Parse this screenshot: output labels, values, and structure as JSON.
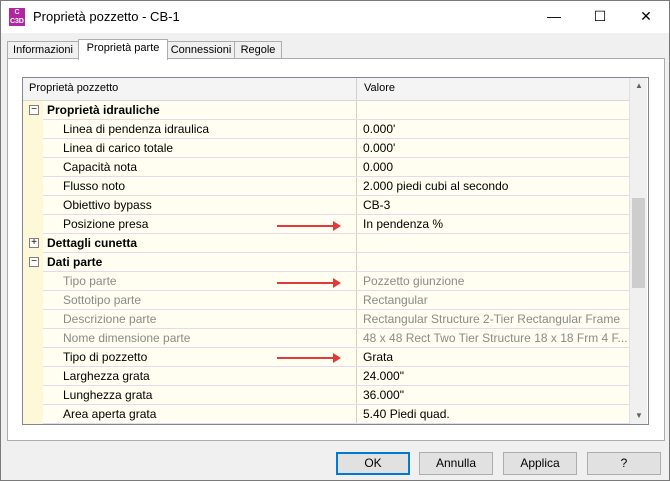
{
  "window": {
    "title": "Proprietà pozzetto - CB-1",
    "app_icon_text": "C\nC3D"
  },
  "window_controls": {
    "minimize": "—",
    "maximize": "☐",
    "close": "✕"
  },
  "tabs": [
    "Informazioni",
    "Proprietà parte",
    "Connessioni",
    "Regole"
  ],
  "active_tab": 1,
  "grid": {
    "col_name": "Proprietà pozzetto",
    "col_value": "Valore",
    "rows": [
      {
        "type": "category",
        "label": "Proprietà idrauliche",
        "expander": "−"
      },
      {
        "type": "prop",
        "label": "Linea di pendenza idraulica",
        "value": "0.000'"
      },
      {
        "type": "prop",
        "label": "Linea di carico totale",
        "value": "0.000'"
      },
      {
        "type": "prop",
        "label": "Capacità nota",
        "value": "0.000"
      },
      {
        "type": "prop",
        "label": "Flusso noto",
        "value": "2.000 piedi cubi al secondo"
      },
      {
        "type": "prop",
        "label": "Obiettivo bypass",
        "value": "CB-3"
      },
      {
        "type": "prop",
        "label": "Posizione presa",
        "value": "In pendenza %"
      },
      {
        "type": "category",
        "label": "Dettagli cunetta",
        "expander": "+"
      },
      {
        "type": "category",
        "label": "Dati parte",
        "expander": "−"
      },
      {
        "type": "disabled",
        "label": "Tipo parte",
        "value": "Pozzetto giunzione"
      },
      {
        "type": "disabled",
        "label": "Sottotipo parte",
        "value": "Rectangular"
      },
      {
        "type": "disabled",
        "label": "Descrizione parte",
        "value": "Rectangular Structure 2-Tier Rectangular Frame"
      },
      {
        "type": "disabled",
        "label": "Nome dimensione parte",
        "value": "48 x 48 Rect Two Tier Structure 18 x 18 Frm 4 F..."
      },
      {
        "type": "prop",
        "label": "Tipo di pozzetto",
        "value": "Grata"
      },
      {
        "type": "prop",
        "label": "Larghezza grata",
        "value": "24.000\""
      },
      {
        "type": "prop",
        "label": "Lunghezza grata",
        "value": "36.000\""
      },
      {
        "type": "prop",
        "label": "Area aperta grata",
        "value": "5.40 Piedi quad."
      }
    ]
  },
  "scrollbar": {
    "up": "▲",
    "down": "▼"
  },
  "buttons": {
    "ok": "OK",
    "cancel": "Annulla",
    "apply": "Applica",
    "help": "?"
  },
  "colors": {
    "arrow": "#e03a3a",
    "row_bg": "#fffef0",
    "app_icon": "#b0279f"
  }
}
